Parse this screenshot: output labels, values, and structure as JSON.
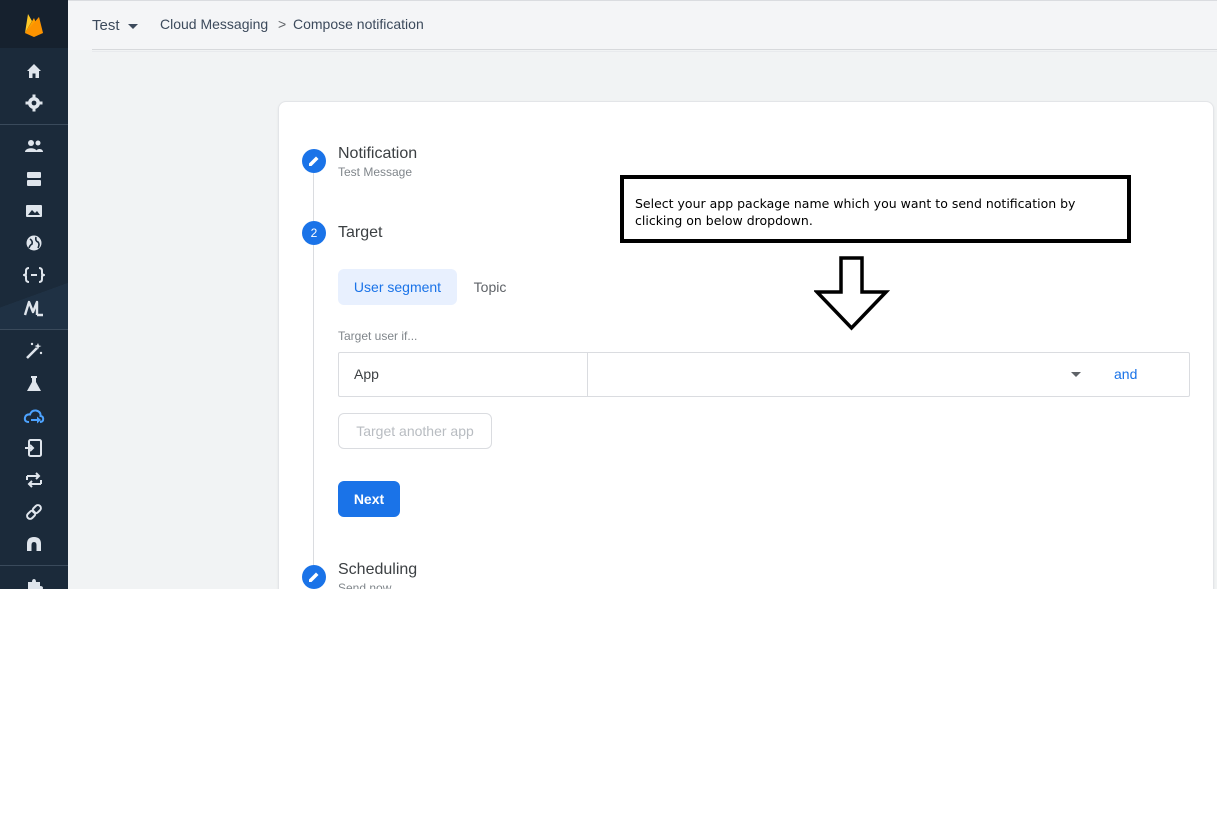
{
  "header": {
    "project": "Test",
    "breadcrumb": [
      "Cloud Messaging",
      "Compose notification"
    ],
    "separator": ">"
  },
  "sidebar": {
    "icons": [
      "firebase-logo-icon",
      "home-icon",
      "gear-icon",
      "users-icon",
      "database-icon",
      "image-icon",
      "globe-icon",
      "functions-icon",
      "ml-icon",
      "magic-wand-icon",
      "flask-icon",
      "cloud-messaging-icon",
      "in-app-messaging-icon",
      "remote-config-icon",
      "link-icon",
      "analytics-icon",
      "extensions-icon"
    ]
  },
  "steps": [
    {
      "title": "Notification",
      "subtitle": "Test Message",
      "icon": "pencil-icon"
    },
    {
      "number": "2",
      "title": "Target"
    },
    {
      "title": "Scheduling",
      "subtitle": "Send now",
      "icon": "pencil-icon"
    }
  ],
  "target": {
    "tabs": [
      "User segment",
      "Topic"
    ],
    "label": "Target user if...",
    "app_label": "App",
    "and_label": "and",
    "another_app": "Target another app",
    "next": "Next"
  },
  "annotation": {
    "text": "Select your app package name which you want to send notification by clicking on below dropdown."
  },
  "colors": {
    "accent": "#1a73e8",
    "sidebar": "#1b2a3a",
    "firebase_yellow": "#ffca28",
    "firebase_orange": "#ffa000"
  }
}
